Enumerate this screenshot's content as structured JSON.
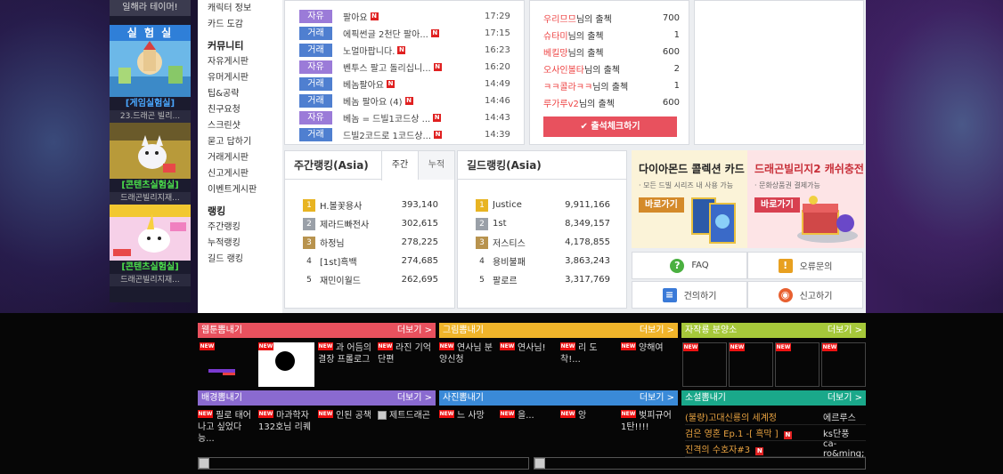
{
  "promo": {
    "top_text": "일해라 테이머!",
    "header": "실 험 실",
    "items": [
      {
        "label": "[게임실험실]",
        "sub": "23.드래곤 빌리...",
        "color": "#4aa8ff"
      },
      {
        "label": "[콘텐츠실험실]",
        "sub": "드래곤빌리지재...",
        "color": "#4be04b"
      },
      {
        "label": "[콘텐츠실험실]",
        "sub": "드래곤빌리지재...",
        "color": "#4be04b"
      }
    ]
  },
  "nav": {
    "items1": [
      "캐릭터 정보",
      "카드 도감"
    ],
    "community_title": "커뮤니티",
    "community": [
      "자유게시판",
      "유머게시판",
      "팁&공략",
      "친구요청",
      "스크린샷",
      "묻고 답하기",
      "거래게시판",
      "신고게시판",
      "이벤트게시판"
    ],
    "ranking_title": "랭킹",
    "ranking": [
      "주간랭킹",
      "누적랭킹",
      "길드 랭킹"
    ]
  },
  "board": {
    "rows": [
      {
        "tag": "자유",
        "type": "free",
        "title": "팔아요",
        "new": true,
        "time": "17:29"
      },
      {
        "tag": "거래",
        "type": "trade",
        "title": "에픽썬글 2천단 팔아...",
        "new": true,
        "time": "17:15"
      },
      {
        "tag": "거래",
        "type": "trade",
        "title": "노멀마팝니다.",
        "new": true,
        "time": "16:23"
      },
      {
        "tag": "자유",
        "type": "free",
        "title": "벤투스 팔고 돌리십니...",
        "new": true,
        "time": "16:20"
      },
      {
        "tag": "거래",
        "type": "trade",
        "title": "베놈팔아요",
        "new": true,
        "time": "14:49"
      },
      {
        "tag": "거래",
        "type": "trade",
        "title": "베놈 팔아요 (4)",
        "new": true,
        "time": "14:46"
      },
      {
        "tag": "자유",
        "type": "free",
        "title": "베놈 = 드빌1코드상 ...",
        "new": true,
        "time": "14:43"
      },
      {
        "tag": "거래",
        "type": "trade",
        "title": "드빌2코드로 1코드상...",
        "new": true,
        "time": "14:39"
      }
    ]
  },
  "attendance": {
    "suffix": "님의 출첵",
    "rows": [
      {
        "name": "우리므므",
        "count": "700"
      },
      {
        "name": "슈타미",
        "count": "1"
      },
      {
        "name": "베킬망",
        "count": "600"
      },
      {
        "name": "오사인볼타",
        "count": "2"
      },
      {
        "name": "ㅋㅋ콜라ㅋㅋ",
        "count": "1"
      },
      {
        "name": "루가루v2",
        "count": "600"
      }
    ],
    "button": "출석체크하기"
  },
  "weekly_rank": {
    "title": "주간랭킹(Asia)",
    "tabs": [
      "주간",
      "누적"
    ],
    "rows": [
      {
        "rank": "1",
        "name": "H.볼꽃용사",
        "score": "393,140"
      },
      {
        "rank": "2",
        "name": "제라드빠전사",
        "score": "302,615"
      },
      {
        "rank": "3",
        "name": "하정님",
        "score": "278,225"
      },
      {
        "rank": "4",
        "name": "[1st]흑백",
        "score": "274,685"
      },
      {
        "rank": "5",
        "name": "재민이월드",
        "score": "262,695"
      }
    ]
  },
  "guild_rank": {
    "title": "길드랭킹(Asia)",
    "rows": [
      {
        "rank": "1",
        "name": "Justice",
        "score": "9,911,166"
      },
      {
        "rank": "2",
        "name": "1st",
        "score": "8,349,157"
      },
      {
        "rank": "3",
        "name": "저스티스",
        "score": "4,178,855"
      },
      {
        "rank": "4",
        "name": "용비불패",
        "score": "3,863,243"
      },
      {
        "rank": "5",
        "name": "팔로르",
        "score": "3,317,769"
      }
    ]
  },
  "ads": {
    "ad1": {
      "title": "다이아몬드 콜렉션 카드",
      "sub": "· 모든 드빌 시리즈 내 사용 가능",
      "button": "바로가기"
    },
    "ad2": {
      "title": "드래곤빌리지2 캐쉬충전",
      "sub": "· 문화상품권 결제가능",
      "button": "바로가기"
    }
  },
  "help": {
    "faq": "FAQ",
    "error": "오류문의",
    "suggest": "건의하기",
    "report": "신고하기"
  },
  "sections": {
    "more": "더보기 >",
    "new_badge": "NEW",
    "webtoon": {
      "title": "웹툰뽐내기",
      "color": "#e8515e",
      "items": [
        "과 어듬의 결장 프롤로그",
        "라진 기억 단편"
      ]
    },
    "drawing": {
      "title": "그림뽐내기",
      "color": "#f0b42a",
      "items": [
        "연사님 분양신청",
        "연사님!",
        "리 도착!...",
        "양해여"
      ]
    },
    "sale": {
      "title": "자작룡 분양소",
      "color": "#a6c83a"
    },
    "background": {
      "title": "배경뽐내기",
      "color": "#8a6ad0",
      "items": [
        "필로 태어나고 싶었다 능...",
        "마과학자 132호님 리퀘",
        "인된 공책",
        "제트드래곤"
      ]
    },
    "photo": {
      "title": "사진뽐내기",
      "color": "#3a8ad8",
      "items": [
        "느 사망",
        "을...",
        "앙",
        "벚피규어 1탄!!!!"
      ]
    },
    "novel": {
      "title": "소설뽐내기",
      "color": "#1aa88a",
      "rows": [
        {
          "title": "(불량)고대신룡의 세계정",
          "author": "에르루스",
          "new": false
        },
        {
          "title": "검은 영혼 Ep.1 -[ 흑막 ]",
          "author": "ks단풍",
          "new": true
        },
        {
          "title": "진격의 수호자#3",
          "author": "ca-ro&ming;",
          "new": true
        }
      ]
    }
  }
}
